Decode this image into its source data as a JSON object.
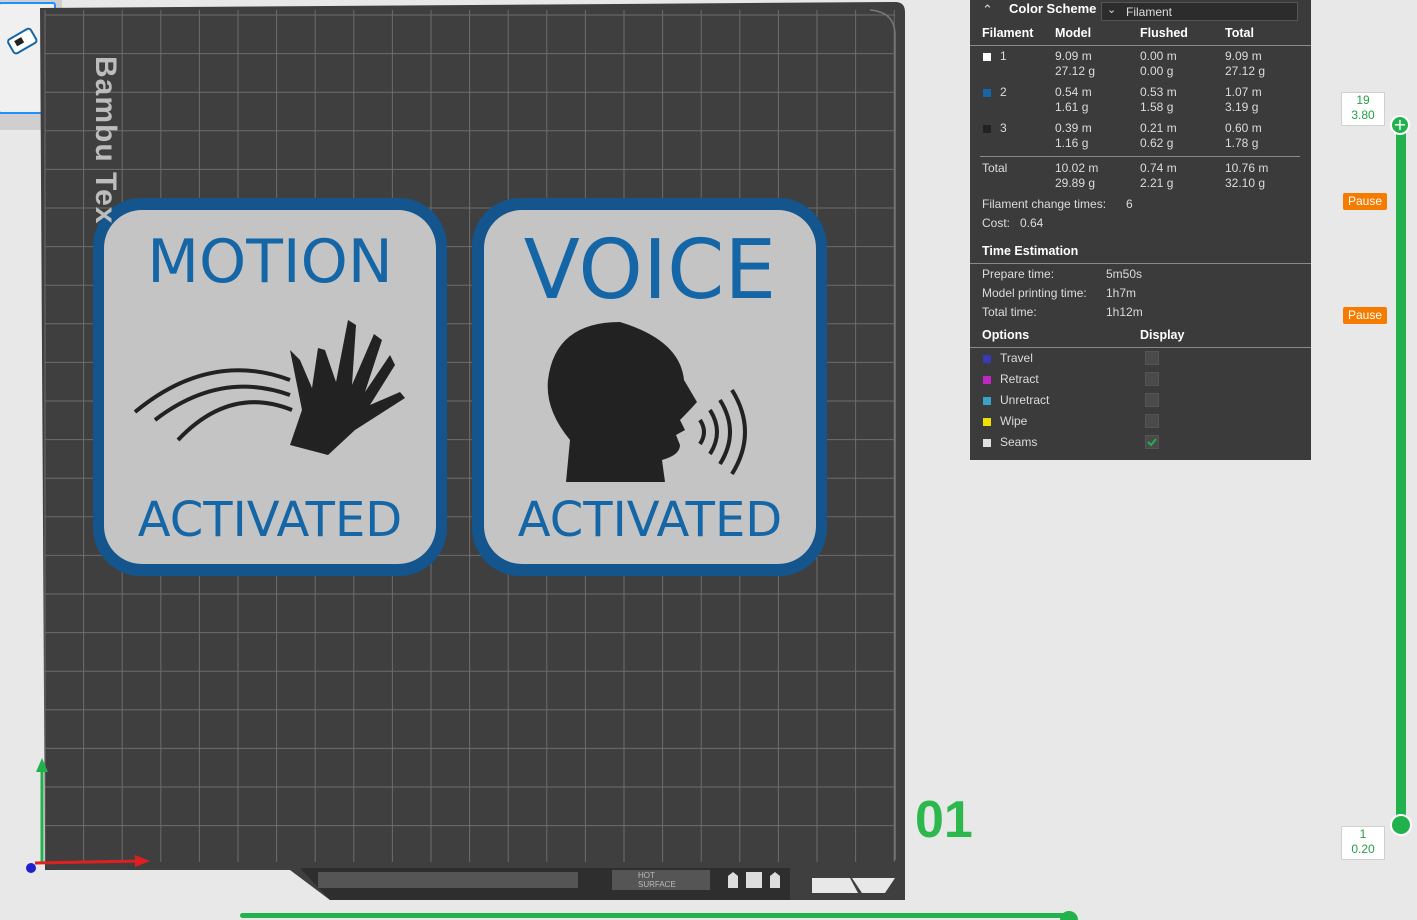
{
  "plate": {
    "brand_text": "Bambu Tex",
    "bed_text": "HOT SURFACE"
  },
  "signs": [
    {
      "top": "MOTION",
      "bottom": "ACTIVATED"
    },
    {
      "top": "VOICE",
      "bottom": "ACTIVATED"
    }
  ],
  "layer_number": "01",
  "panel": {
    "title": "Color Scheme",
    "scheme_value": "Filament",
    "headers": {
      "filament": "Filament",
      "model": "Model",
      "flushed": "Flushed",
      "total": "Total"
    },
    "rows": [
      {
        "id": "1",
        "color": "#ffffff",
        "model_m": "9.09 m",
        "model_g": "27.12 g",
        "flushed_m": "0.00 m",
        "flushed_g": "0.00 g",
        "total_m": "9.09 m",
        "total_g": "27.12 g"
      },
      {
        "id": "2",
        "color": "#1566a6",
        "model_m": "0.54 m",
        "model_g": "1.61 g",
        "flushed_m": "0.53 m",
        "flushed_g": "1.58 g",
        "total_m": "1.07 m",
        "total_g": "3.19 g"
      },
      {
        "id": "3",
        "color": "#222222",
        "model_m": "0.39 m",
        "model_g": "1.16 g",
        "flushed_m": "0.21 m",
        "flushed_g": "0.62 g",
        "total_m": "0.60 m",
        "total_g": "1.78 g"
      }
    ],
    "total": {
      "label": "Total",
      "model_m": "10.02 m",
      "model_g": "29.89 g",
      "flushed_m": "0.74 m",
      "flushed_g": "2.21 g",
      "total_m": "10.76 m",
      "total_g": "32.10 g"
    },
    "filament_change_label": "Filament change times:",
    "filament_change_value": "6",
    "cost_label": "Cost:",
    "cost_value": "0.64",
    "time_title": "Time Estimation",
    "prepare_label": "Prepare time:",
    "prepare_value": "5m50s",
    "model_time_label": "Model printing time:",
    "model_time_value": "1h7m",
    "total_time_label": "Total time:",
    "total_time_value": "1h12m",
    "options_title": "Options",
    "display_title": "Display",
    "options": [
      {
        "label": "Travel",
        "color": "#3a3ab8",
        "checked": false
      },
      {
        "label": "Retract",
        "color": "#c026c0",
        "checked": false
      },
      {
        "label": "Unretract",
        "color": "#3aa3c8",
        "checked": false
      },
      {
        "label": "Wipe",
        "color": "#f0e000",
        "checked": false
      },
      {
        "label": "Seams",
        "color": "#e0e0e0",
        "checked": true
      }
    ]
  },
  "slider": {
    "top_layer": "19",
    "top_height": "3.80",
    "bottom_layer": "1",
    "bottom_height": "0.20",
    "pause_label": "Pause"
  },
  "colors": {
    "accent": "#22b14c",
    "pause": "#f57c00",
    "sign_blue": "#1566a6",
    "plate": "#3f3f3f"
  }
}
